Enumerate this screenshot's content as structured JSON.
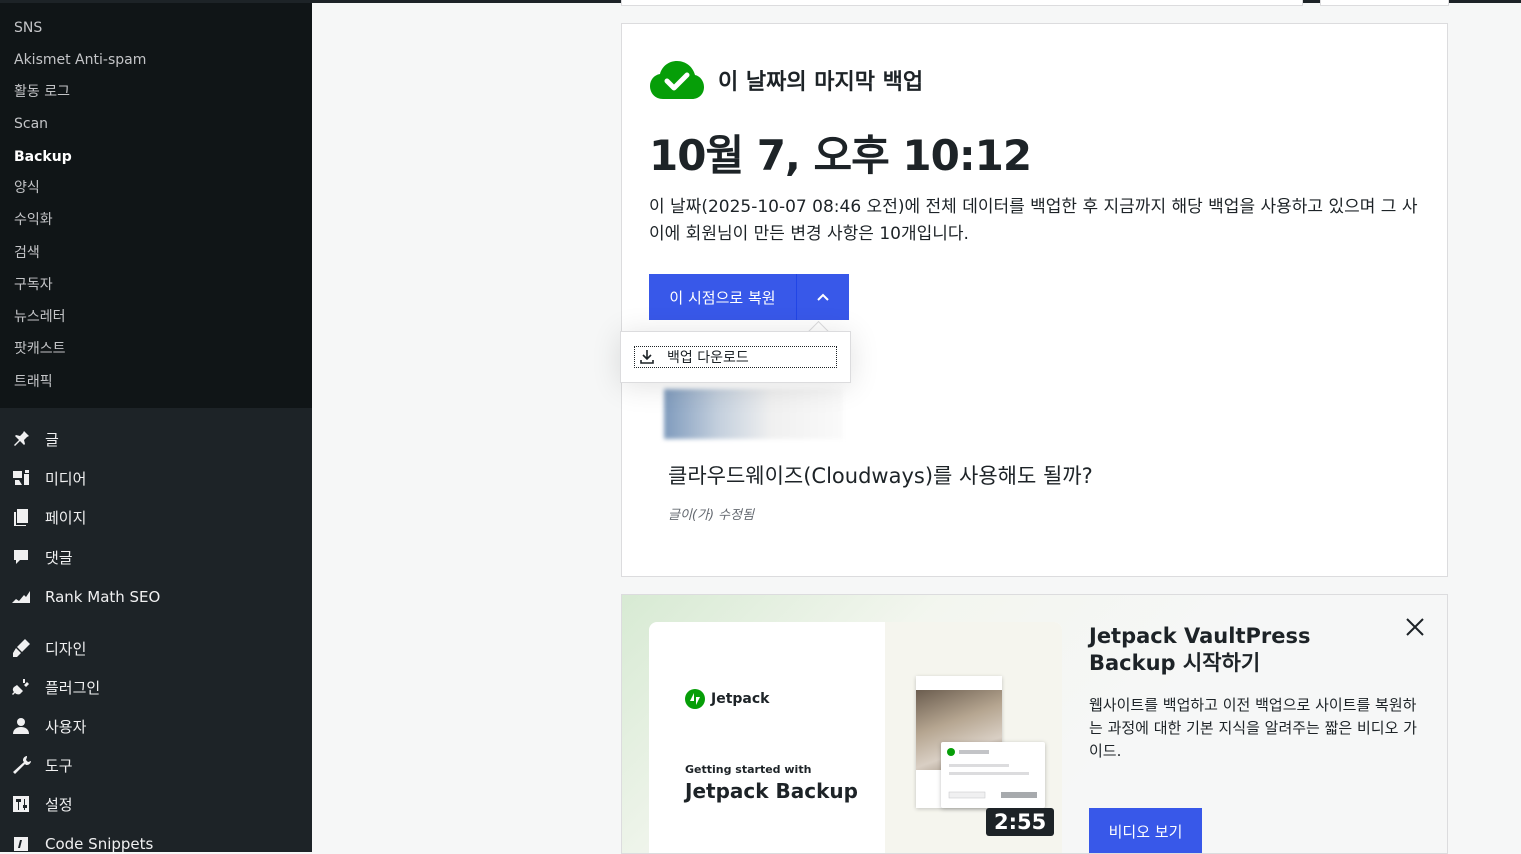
{
  "sidebar": {
    "submenu": [
      "SNS",
      "Akismet Anti-spam",
      "활동 로그",
      "Scan",
      "Backup",
      "양식",
      "수익화",
      "검색",
      "구독자",
      "뉴스레터",
      "팟캐스트",
      "트래픽"
    ],
    "active_submenu": "Backup",
    "menu": [
      {
        "label": "글",
        "icon": "pin-icon"
      },
      {
        "label": "미디어",
        "icon": "media-icon"
      },
      {
        "label": "페이지",
        "icon": "pages-icon"
      },
      {
        "label": "댓글",
        "icon": "comments-icon"
      },
      {
        "label": "Rank Math SEO",
        "icon": "rank-math-icon"
      },
      {
        "label": "디자인",
        "icon": "appearance-icon"
      },
      {
        "label": "플러그인",
        "icon": "plugins-icon"
      },
      {
        "label": "사용자",
        "icon": "users-icon"
      },
      {
        "label": "도구",
        "icon": "tools-icon"
      },
      {
        "label": "설정",
        "icon": "settings-icon"
      },
      {
        "label": "Code Snippets",
        "icon": "code-icon"
      }
    ]
  },
  "backup": {
    "heading": "이 날짜의 마지막 백업",
    "date": "10월 7, 오후 10:12",
    "description": "이 날짜(2025-10-07 08:46 오전)에 전체 데이터를 백업한 후 지금까지 해당 백업을 사용하고 있으며 그 사이에 회원님이 만든 변경 사항은 10개입니다.",
    "restore_label": "이 시점으로 복원",
    "status_color": "#069e08",
    "dropdown": {
      "download_label": "백업 다운로드"
    },
    "post": {
      "title": "클라우드웨이즈(Cloudways)를 사용해도 될까?",
      "meta": "글이(가) 수정됨"
    }
  },
  "promo": {
    "title": "Jetpack VaultPress Backup 시작하기",
    "description": "웹사이트를 백업하고 이전 백업으로 사이트를 복원하는 과정에 대한 기본 지식을 알려주는 짧은 비디오 가이드.",
    "button_label": "비디오 보기",
    "video": {
      "logo_text": "Jetpack",
      "subtitle": "Getting started with",
      "main_title": "Jetpack Backup",
      "duration": "2:55"
    }
  },
  "colors": {
    "accent": "#3858e9",
    "sidebar_bg": "#1d2327",
    "submenu_bg": "#101517"
  }
}
